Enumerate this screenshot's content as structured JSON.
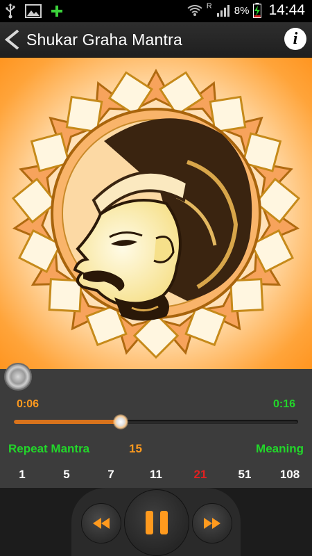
{
  "status": {
    "roaming": "R",
    "battery": "8%",
    "time": "14:44"
  },
  "header": {
    "title": "Shukar Graha Mantra"
  },
  "player": {
    "elapsed": "0:06",
    "total": "0:16",
    "progress": 0.375
  },
  "repeat": {
    "label": "Repeat Mantra",
    "count": "15",
    "meaning_label": "Meaning",
    "options": [
      "1",
      "5",
      "7",
      "11",
      "21",
      "51",
      "108"
    ],
    "selected_index": 4
  },
  "colors": {
    "accent_orange": "#ff9a1e",
    "accent_green": "#22d62a",
    "selected_red": "#e02020"
  },
  "icons": {
    "back": "back-arrow-icon",
    "info": "info-icon",
    "rewind": "rewind-icon",
    "pause": "pause-icon",
    "fast_forward": "fast-forward-icon"
  }
}
